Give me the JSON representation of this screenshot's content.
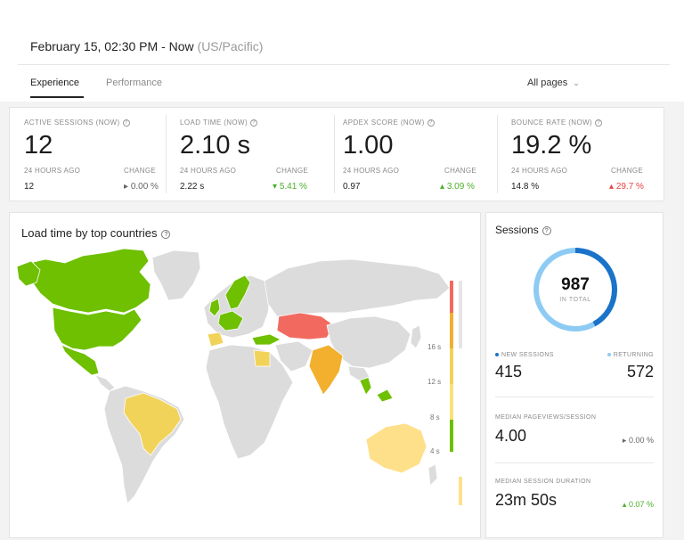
{
  "header": {
    "date_range": "February 15, 02:30 PM - Now",
    "timezone": "(US/Pacific)",
    "tabs": [
      {
        "label": "Experience",
        "active": true
      },
      {
        "label": "Performance",
        "active": false
      }
    ],
    "pages_select": "All pages"
  },
  "stats": [
    {
      "label": "ACTIVE SESSIONS (NOW)",
      "value": "12",
      "prev_label": "24 HOURS AGO",
      "prev_value": "12",
      "change_label": "CHANGE",
      "change_value": "0.00 %",
      "change_icon": "▸"
    },
    {
      "label": "LOAD TIME (NOW)",
      "value": "2.10 s",
      "prev_label": "24 HOURS AGO",
      "prev_value": "2.22 s",
      "change_label": "CHANGE",
      "change_value": "5.41 %",
      "change_icon": "▾"
    },
    {
      "label": "APDEX SCORE (NOW)",
      "value": "1.00",
      "prev_label": "24 HOURS AGO",
      "prev_value": "0.97",
      "change_label": "CHANGE",
      "change_value": "3.09 %",
      "change_icon": "▴"
    },
    {
      "label": "BOUNCE RATE (NOW)",
      "value": "19.2 %",
      "prev_label": "24 HOURS AGO",
      "prev_value": "14.8 %",
      "change_label": "CHANGE",
      "change_value": "29.7 %",
      "change_icon": "▴"
    }
  ],
  "map": {
    "title": "Load time by top countries",
    "legend_ticks": [
      "16 s",
      "12 s",
      "8 s",
      "4 s"
    ],
    "colors": {
      "fast": "#6ec000",
      "ok": "#f1d35a",
      "medium": "#f2b02e",
      "slow": "#f26a5f",
      "none": "#dcdcdc"
    }
  },
  "sessions": {
    "title": "Sessions",
    "total": "987",
    "total_caption": "IN TOTAL",
    "new_label": "NEW SESSIONS",
    "new_value": "415",
    "new_fraction": 0.42,
    "returning_label": "RETURNING",
    "returning_value": "572",
    "colors": {
      "new": "#1a73c9",
      "returning": "#8ecbf4"
    },
    "metrics": [
      {
        "label": "MEDIAN PAGEVIEWS/SESSION",
        "value": "4.00",
        "change": "0.00 %",
        "change_icon": "▸"
      },
      {
        "label": "MEDIAN SESSION DURATION",
        "value": "23m 50s",
        "change": "0.07 %",
        "change_icon": "▴"
      }
    ]
  }
}
